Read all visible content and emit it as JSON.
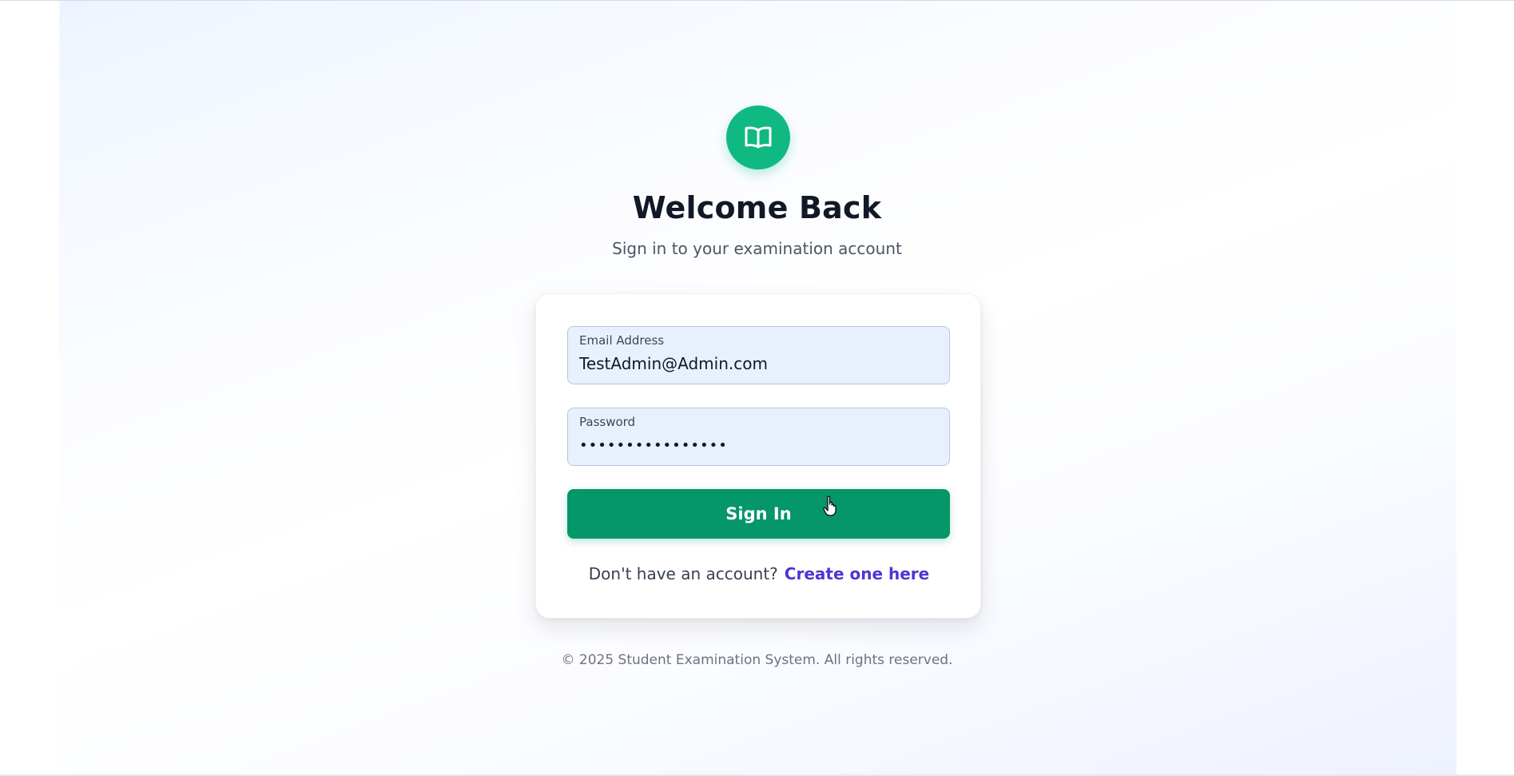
{
  "header": {
    "logo_icon": "book-open-icon",
    "title": "Welcome Back",
    "subtitle": "Sign in to your examination account"
  },
  "form": {
    "email": {
      "label": "Email Address",
      "value": "TestAdmin@Admin.com"
    },
    "password": {
      "label": "Password",
      "value": "••••••••••••••••"
    },
    "submit_label": "Sign In",
    "register_prompt": "Don't have an account?",
    "register_link": "Create one here"
  },
  "footer": {
    "copyright": "© 2025 Student Examination System. All rights reserved."
  },
  "colors": {
    "brand_green": "#10b981",
    "button_green": "#059669",
    "link_purple": "#4f35d2",
    "input_bg": "#e8f0fe"
  }
}
